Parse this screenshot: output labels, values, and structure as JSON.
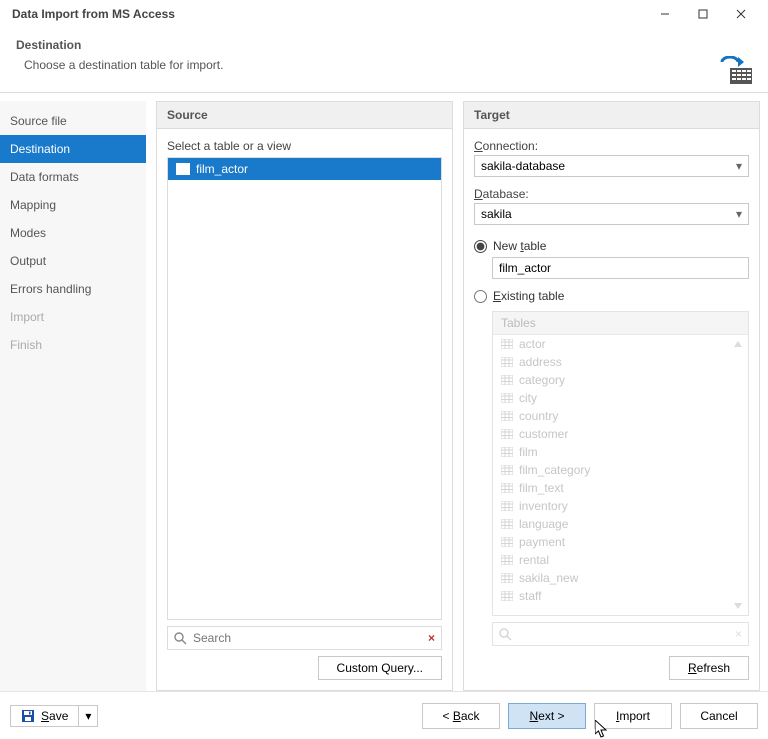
{
  "window": {
    "title": "Data Import from MS Access"
  },
  "header": {
    "title": "Destination",
    "desc": "Choose a destination table for import."
  },
  "steps": {
    "items": [
      {
        "label": "Source file",
        "state": "normal"
      },
      {
        "label": "Destination",
        "state": "active"
      },
      {
        "label": "Data formats",
        "state": "normal"
      },
      {
        "label": "Mapping",
        "state": "normal"
      },
      {
        "label": "Modes",
        "state": "normal"
      },
      {
        "label": "Output",
        "state": "normal"
      },
      {
        "label": "Errors handling",
        "state": "normal"
      },
      {
        "label": "Import",
        "state": "disabled"
      },
      {
        "label": "Finish",
        "state": "disabled"
      }
    ]
  },
  "source": {
    "title": "Source",
    "select_label": "Select a table or a view",
    "items": [
      {
        "name": "film_actor"
      }
    ],
    "search_placeholder": "Search",
    "custom_query_label": "Custom Query..."
  },
  "target": {
    "title": "Target",
    "connection_label": "Connection:",
    "connection_value": "sakila-database",
    "database_label": "Database:",
    "database_value": "sakila",
    "new_table_label": "New table",
    "new_table_value": "film_actor",
    "existing_table_label": "Existing table",
    "tables_header": "Tables",
    "tables": [
      "actor",
      "address",
      "category",
      "city",
      "country",
      "customer",
      "film",
      "film_category",
      "film_text",
      "inventory",
      "language",
      "payment",
      "rental",
      "sakila_new",
      "staff"
    ],
    "refresh_label": "Refresh"
  },
  "footer": {
    "save_label": "Save",
    "back_label": "< Back",
    "next_label": "Next >",
    "import_label": "Import",
    "cancel_label": "Cancel"
  }
}
